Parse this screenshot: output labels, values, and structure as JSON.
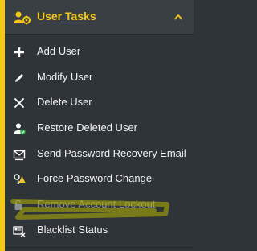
{
  "header": {
    "title": "User Tasks",
    "icon": "users-gear-icon",
    "chevron": "chevron-up-icon",
    "accent_color": "#f2c718"
  },
  "menu": {
    "items": [
      {
        "label": "Add User",
        "icon": "plus-icon"
      },
      {
        "label": "Modify User",
        "icon": "pencil-icon"
      },
      {
        "label": "Delete User",
        "icon": "x-icon"
      },
      {
        "label": "Restore Deleted User",
        "icon": "restore-user-icon"
      },
      {
        "label": "Send Password Recovery Email",
        "icon": "envelope-icon"
      },
      {
        "label": "Force Password Change",
        "icon": "key-warning-icon"
      },
      {
        "label": "Remove Account Lockout",
        "icon": "unlock-icon",
        "state": "disabled"
      },
      {
        "label": "Blacklist Status",
        "icon": "blacklist-icon"
      }
    ]
  },
  "annotation": {
    "highlight_color": "#b6b400"
  }
}
